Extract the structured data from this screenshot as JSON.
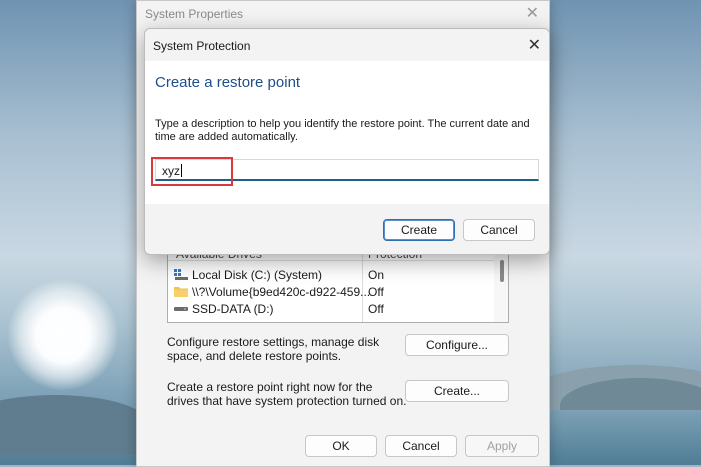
{
  "background_window": {
    "title": "System Properties",
    "close_glyph": "✕",
    "drives_table": {
      "col_drives": "Available Drives",
      "col_protection": "Protection",
      "rows": [
        {
          "name": "Local Disk (C:) (System)",
          "protection": "On",
          "icon": "system-drive-icon"
        },
        {
          "name": "\\\\?\\Volume{b9ed420c-d922-459...",
          "protection": "Off",
          "icon": "folder-drive-icon"
        },
        {
          "name": "SSD-DATA (D:)",
          "protection": "Off",
          "icon": "drive-icon"
        }
      ]
    },
    "configure_text": "Configure restore settings, manage disk space, and delete restore points.",
    "configure_button": "Configure...",
    "create_text": "Create a restore point right now for the drives that have system protection turned on.",
    "create_button": "Create...",
    "ok_button": "OK",
    "cancel_button": "Cancel",
    "apply_button": "Apply"
  },
  "dialog": {
    "title": "System Protection",
    "close_glyph": "✕",
    "heading": "Create a restore point",
    "description": "Type a description to help you identify the restore point. The current date and time are added automatically.",
    "input_value": "xyz",
    "create_button": "Create",
    "cancel_button": "Cancel"
  },
  "colors": {
    "heading": "#1f4e8a",
    "highlight_box": "#d9393b",
    "input_underline": "#1f5f8b"
  }
}
